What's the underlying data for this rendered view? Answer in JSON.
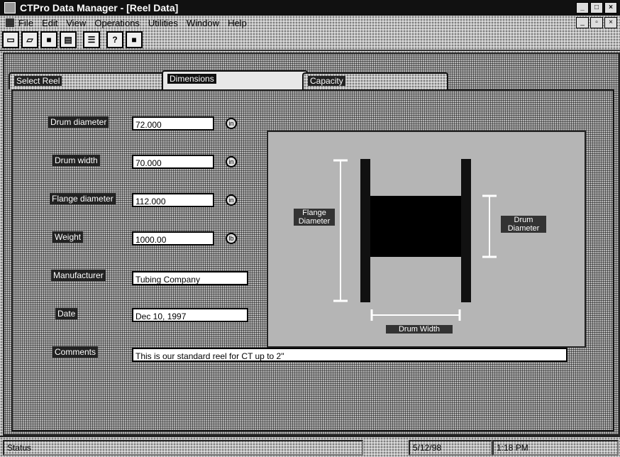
{
  "window": {
    "title": "CTPro Data Manager - [Reel Data]"
  },
  "menu": [
    "File",
    "Edit",
    "View",
    "Operations",
    "Utilities",
    "Window",
    "Help"
  ],
  "tabs": [
    "Select Reel",
    "Dimensions",
    "Capacity"
  ],
  "form": {
    "drum_diameter": {
      "label": "Drum diameter",
      "value": "72.000"
    },
    "drum_width": {
      "label": "Drum width",
      "value": "70.000"
    },
    "flange_diameter": {
      "label": "Flange diameter",
      "value": "112.000"
    },
    "weight": {
      "label": "Weight",
      "value": "1000.00"
    },
    "manufacturer": {
      "label": "Manufacturer",
      "value": "Tubing Company"
    },
    "date": {
      "label": "Date",
      "value": "Dec 10, 1997"
    },
    "comments": {
      "label": "Comments",
      "value": "This is our standard reel for CT up to 2\""
    }
  },
  "diagram": {
    "flange_label": "Flange Diameter",
    "drum_label": "Drum Diameter",
    "width_label": "Drum Width"
  },
  "status": {
    "text": "Status",
    "date": "5/12/98",
    "time": "1:18 PM"
  }
}
